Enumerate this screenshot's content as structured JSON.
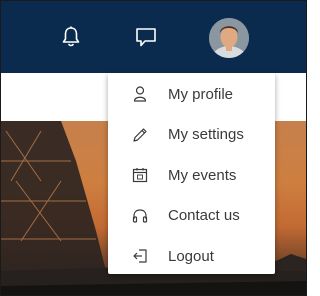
{
  "header": {
    "icons": [
      {
        "name": "bell-icon"
      },
      {
        "name": "chat-icon"
      }
    ],
    "avatar": {
      "name": "user-avatar"
    }
  },
  "menu": {
    "items": [
      {
        "label": "My profile",
        "icon": "user-icon"
      },
      {
        "label": "My settings",
        "icon": "pencil-icon"
      },
      {
        "label": "My events",
        "icon": "calendar-icon"
      },
      {
        "label": "Contact us",
        "icon": "headphones-icon"
      },
      {
        "label": "Logout",
        "icon": "logout-icon"
      }
    ]
  },
  "colors": {
    "topbar": "#0a2b4e",
    "menu_text": "#3a3a3a",
    "icon_white": "#ffffff"
  }
}
